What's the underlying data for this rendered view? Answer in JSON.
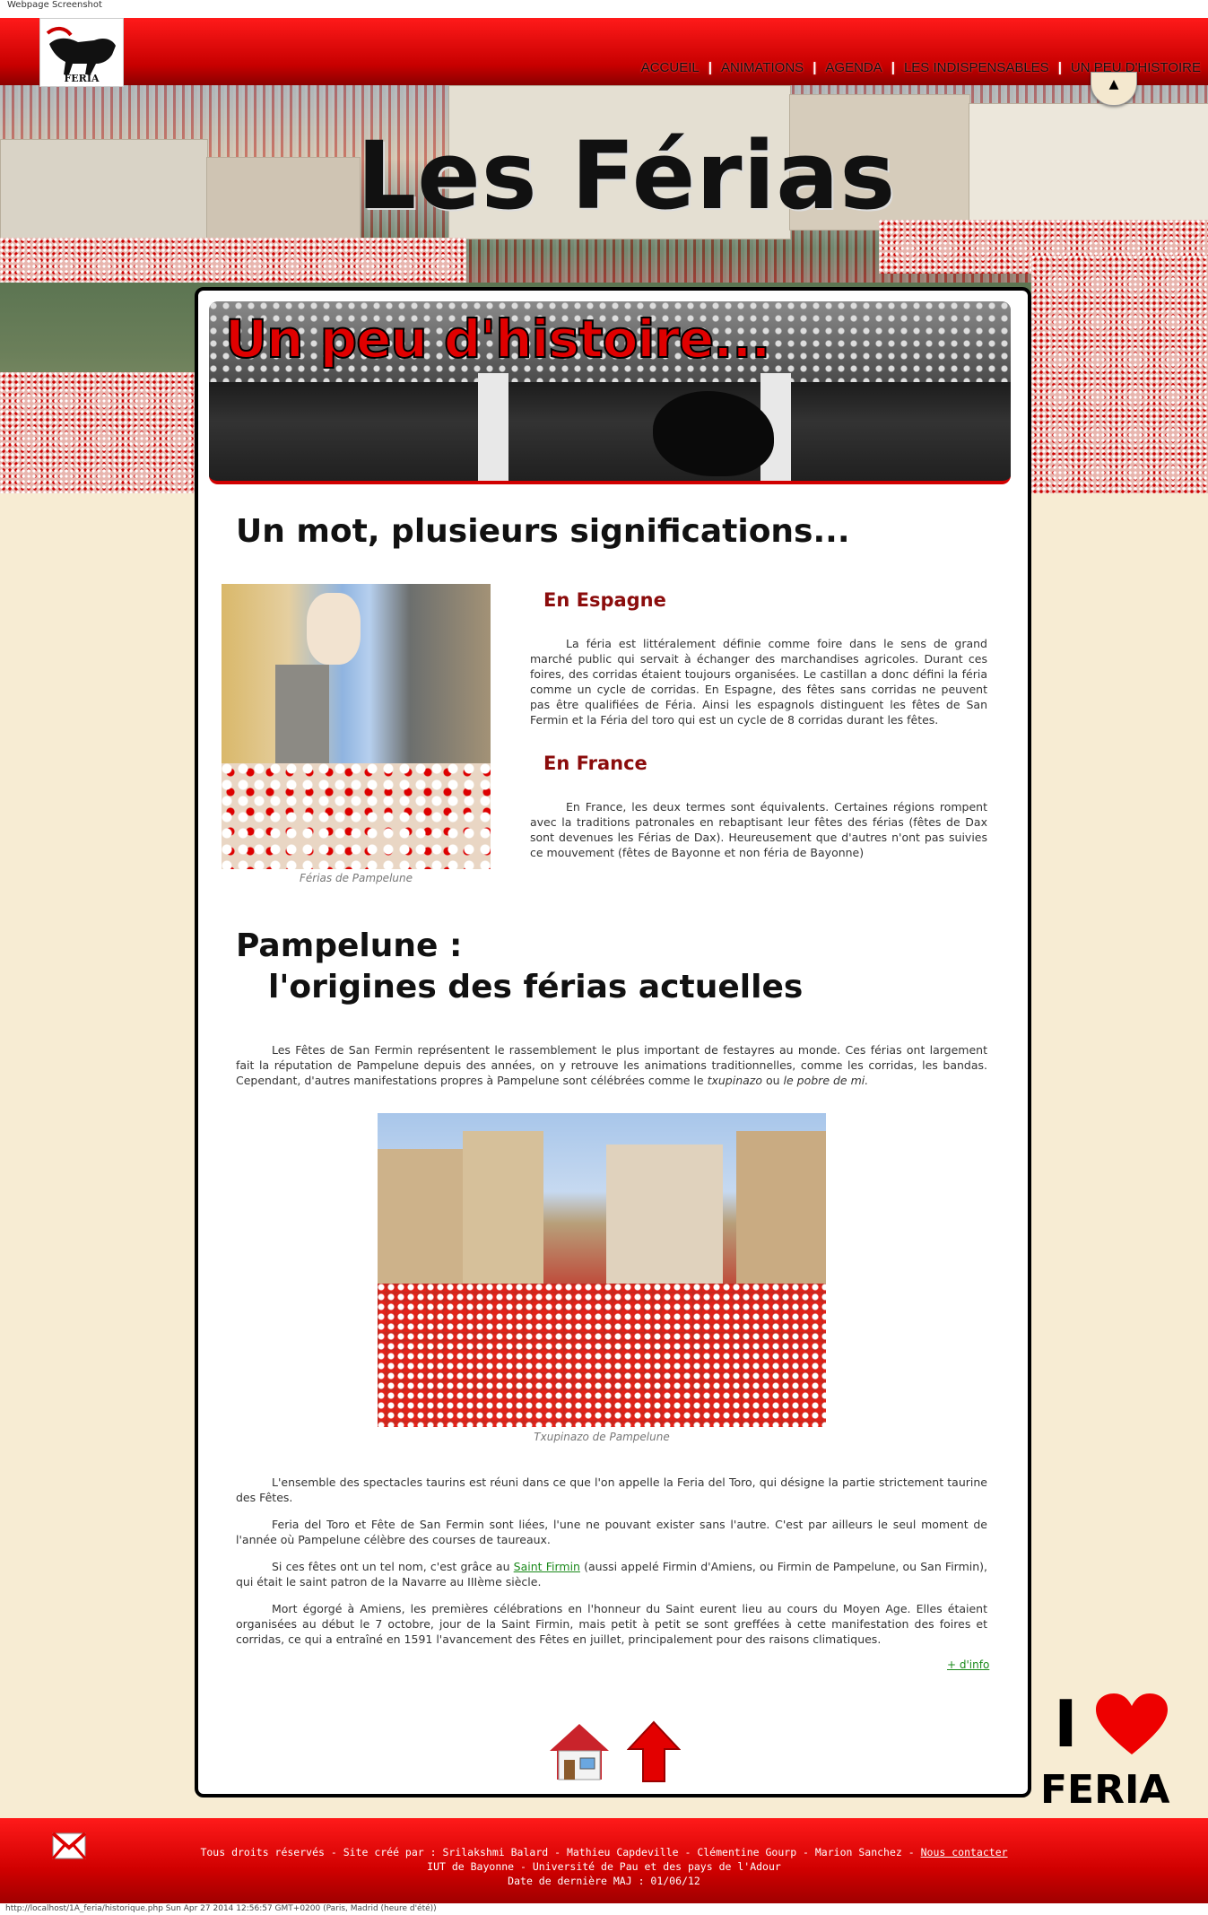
{
  "window": {
    "caption": "Webpage Screenshot"
  },
  "header": {
    "logo_text": "FERIA",
    "site_title": "Les Férias",
    "nav": [
      "ACCUEIL",
      "ANIMATIONS",
      "AGENDA",
      "LES INDISPENSABLES",
      "UN PEU D'HISTOIRE"
    ]
  },
  "banner": {
    "title": "Un peu d'histoire..."
  },
  "section1": {
    "title": "Un mot, plusieurs significations...",
    "photo_caption": "Férias de Pampelune",
    "spain": {
      "title": "En Espagne",
      "text": "La féria est littéralement définie comme foire dans le sens de grand marché public qui servait à échanger des marchandises agricoles. Durant ces foires, des corridas étaient toujours organisées. Le castillan a donc défini la féria comme un cycle de corridas. En Espagne, des fêtes sans corridas ne peuvent pas être qualifiées de Féria. Ainsi les espagnols distinguent les fêtes de San Fermin et la Féria del toro qui est un cycle de 8 corridas durant les fêtes."
    },
    "france": {
      "title": "En France",
      "text": "En France, les deux termes sont équivalents. Certaines régions rompent avec la traditions patronales en rebaptisant leur fêtes des férias (fêtes de Dax sont devenues les Férias de Dax). Heureusement que d'autres n'ont pas suivies ce mouvement (fêtes de Bayonne et non féria de Bayonne)"
    }
  },
  "section2": {
    "title_line1": "Pampelune :",
    "title_line2": "l'origines des férias actuelles",
    "intro": "Les Fêtes de San Fermin représentent le rassemblement le plus important de festayres au monde. Ces férias ont largement fait la réputation de Pampelune depuis des années, on y retrouve les animations traditionnelles, comme les corridas, les bandas. Cependant, d'autres manifestations propres à Pampelune sont célébrées comme le",
    "intro_em1": "txupinazo",
    "intro_mid": "ou",
    "intro_em2": "le pobre de mi.",
    "photo_caption": "Txupinazo de Pampelune",
    "p1": "L'ensemble des spectacles taurins est réuni dans ce que l'on appelle la Feria del Toro, qui désigne la partie strictement taurine des Fêtes.",
    "p2": "Feria del Toro et Fête de San Fermin sont liées, l'une ne pouvant exister sans l'autre. C'est par ailleurs le seul moment de l'année où Pampelune célèbre des courses de taureaux.",
    "p3_before": "Si ces fêtes ont un tel nom, c'est grâce au",
    "p3_link": "Saint Firmin",
    "p3_after": "(aussi appelé Firmin d'Amiens, ou Firmin de Pampelune, ou San Firmin), qui était le saint patron de la Navarre au IIIème siècle.",
    "p4": "Mort égorgé à Amiens, les premières célébrations en l'honneur du Saint eurent lieu au cours du Moyen Age. Elles étaient organisées au début le 7 octobre, jour de la Saint Firmin, mais petit à petit se sont greffées à cette manifestation des foires et corridas, ce qui a entraîné en 1591 l'avancement des Fêtes en juillet, principalement pour des raisons climatiques.",
    "more_link": "+ d'info"
  },
  "badge": {
    "top": "I",
    "bottom": "FERIA"
  },
  "footer": {
    "line1": "Tous droits réservés - Site créé par : Srilakshmi Balard - Mathieu Capdeville - Clémentine Gourp - Marion Sanchez -",
    "contact": "Nous contacter",
    "line2": "IUT de Bayonne - Université de Pau et des pays de l'Adour",
    "line3": "Date de dernière MAJ : 01/06/12"
  },
  "statusbar": "http://localhost/1A_feria/historique.php Sun Apr 27 2014 12:56:57 GMT+0200 (Paris, Madrid (heure d'été))",
  "colors": {
    "primary_red": "#e00000",
    "subtitle_red": "#8b0c0c",
    "link_green": "#1b8a1b"
  }
}
